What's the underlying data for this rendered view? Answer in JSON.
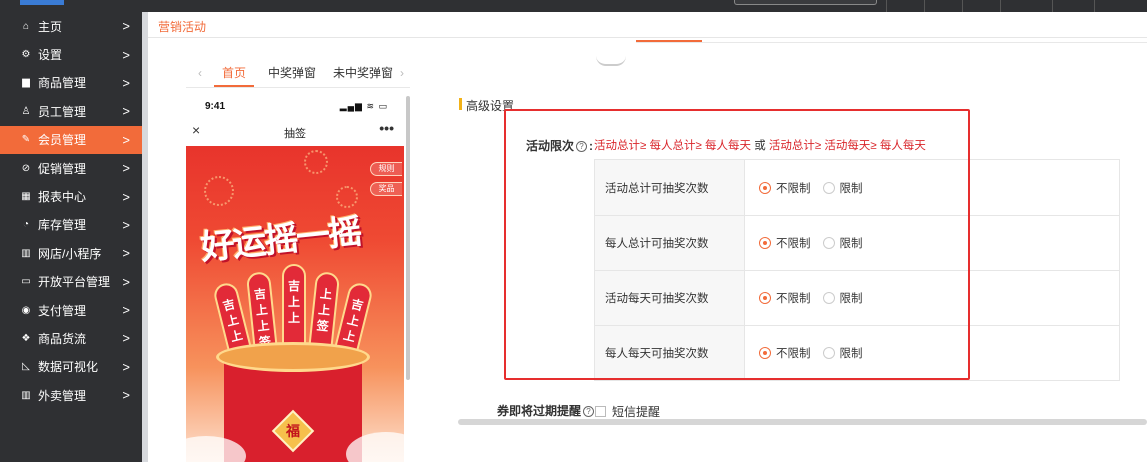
{
  "breadcrumb": "营销活动",
  "sidebar": {
    "items": [
      {
        "label": "主页",
        "icon": "home-icon",
        "glyph": "⌂"
      },
      {
        "label": "设置",
        "icon": "gear-icon",
        "glyph": "⚙"
      },
      {
        "label": "商品管理",
        "icon": "product-icon",
        "glyph": "▆"
      },
      {
        "label": "员工管理",
        "icon": "staff-icon",
        "glyph": "♙"
      },
      {
        "label": "会员管理",
        "icon": "member-icon",
        "glyph": "✎",
        "active": true
      },
      {
        "label": "促销管理",
        "icon": "promotion-icon",
        "glyph": "⊘"
      },
      {
        "label": "报表中心",
        "icon": "report-icon",
        "glyph": "▦"
      },
      {
        "label": "库存管理",
        "icon": "inventory-icon",
        "glyph": "◔"
      },
      {
        "label": "网店/小程序",
        "icon": "shop-icon",
        "glyph": "▥"
      },
      {
        "label": "开放平台管理",
        "icon": "platform-icon",
        "glyph": "▭"
      },
      {
        "label": "支付管理",
        "icon": "payment-icon",
        "glyph": "◉"
      },
      {
        "label": "商品货流",
        "icon": "logistics-icon",
        "glyph": "❖"
      },
      {
        "label": "数据可视化",
        "icon": "chart-icon",
        "glyph": "◺"
      },
      {
        "label": "外卖管理",
        "icon": "delivery-icon",
        "glyph": "▥"
      }
    ],
    "arrow": ">"
  },
  "preview_tabs": {
    "prev": "‹",
    "next": "›",
    "tabs": [
      "首页",
      "中奖弹窗",
      "未中奖弹窗"
    ]
  },
  "phone": {
    "time": "9:41",
    "status_icons": "▂▄▆ ≋ ▭",
    "close": "×",
    "title": "抽签",
    "more": "•••",
    "rules_btn": "规则",
    "prize_btn": "奖品",
    "poster_title": "好运摇一摇",
    "stick_texts": [
      "吉上上",
      "吉上上签",
      "吉上上",
      "上上签",
      "吉上上"
    ],
    "emblem": "福"
  },
  "settings": {
    "section_title": "高级设置",
    "limit_label": "活动限次",
    "help_glyph": "?",
    "rule_part1": "活动总计≥ 每人总计≥ 每人每天",
    "rule_or": "或",
    "rule_part2": "活动总计≥ 活动每天≥ 每人每天",
    "rows": [
      {
        "name": "活动总计可抽奖次数",
        "opt_unlimited": "不限制",
        "opt_limited": "限制"
      },
      {
        "name": "每人总计可抽奖次数",
        "opt_unlimited": "不限制",
        "opt_limited": "限制"
      },
      {
        "name": "活动每天可抽奖次数",
        "opt_unlimited": "不限制",
        "opt_limited": "限制"
      },
      {
        "name": "每人每天可抽奖次数",
        "opt_unlimited": "不限制",
        "opt_limited": "限制"
      }
    ],
    "expire_label": "券即将过期提醒",
    "sms_label": "短信提醒"
  },
  "colors": {
    "accent": "#f26b3a",
    "sidebar_bg": "#2f3033",
    "rule_red": "#d9262b",
    "highlight_red": "#e62e2e"
  }
}
